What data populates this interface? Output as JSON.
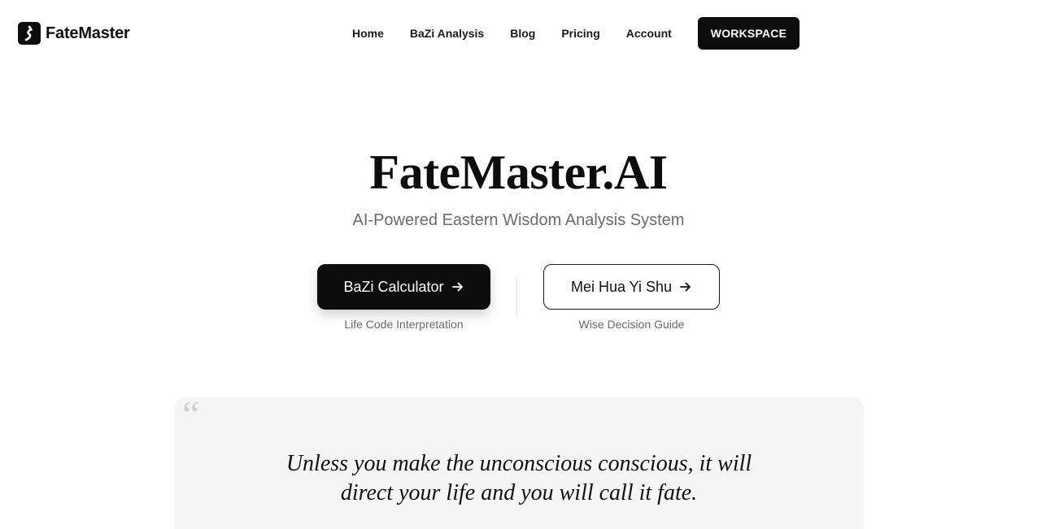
{
  "brand": {
    "name": "FateMaster",
    "logo_icon": "yin-yang-curve-icon"
  },
  "nav": {
    "links": [
      {
        "label": "Home"
      },
      {
        "label": "BaZi Analysis"
      },
      {
        "label": "Blog"
      },
      {
        "label": "Pricing"
      },
      {
        "label": "Account"
      }
    ],
    "workspace_label": "WORKSPACE"
  },
  "hero": {
    "title": "FateMaster.AI",
    "subtitle": "AI-Powered Eastern Wisdom Analysis System"
  },
  "cta": {
    "primary": {
      "label": "BaZi Calculator",
      "caption": "Life Code Interpretation",
      "icon": "arrow-right-icon"
    },
    "secondary": {
      "label": "Mei Hua Yi Shu",
      "caption": "Wise Decision Guide",
      "icon": "arrow-right-icon"
    }
  },
  "quote": {
    "mark": "“",
    "lines": [
      "Unless you make the unconscious conscious, it will",
      "direct your life and you will call it fate."
    ]
  },
  "colors": {
    "primary": "#0d0d0d",
    "muted_text": "#6b6b6b",
    "quote_bg": "#f5f5f5"
  }
}
